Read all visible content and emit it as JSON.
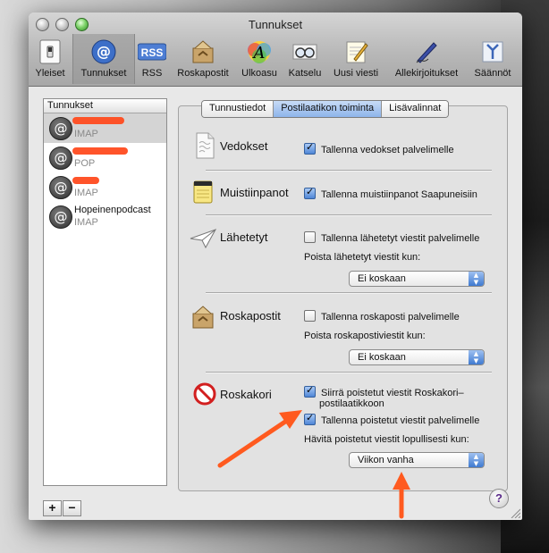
{
  "window": {
    "title": "Tunnukset"
  },
  "toolbar": [
    {
      "name": "yleiset",
      "label": "Yleiset"
    },
    {
      "name": "tunnukset",
      "label": "Tunnukset"
    },
    {
      "name": "rss",
      "label": "RSS"
    },
    {
      "name": "roskapostit",
      "label": "Roskapostit"
    },
    {
      "name": "ulkoasu",
      "label": "Ulkoasu"
    },
    {
      "name": "katselu",
      "label": "Katselu"
    },
    {
      "name": "uusi-viesti",
      "label": "Uusi viesti"
    },
    {
      "name": "allekirjoitukset",
      "label": "Allekirjoitukset"
    },
    {
      "name": "saannot",
      "label": "Säännöt"
    }
  ],
  "toolbar_rss_icon_text": "RSS",
  "accounts": {
    "header": "Tunnukset",
    "items": [
      {
        "name": "",
        "type": "IMAP",
        "selected": true
      },
      {
        "name": "",
        "type": "POP",
        "selected": false
      },
      {
        "name": "",
        "type": "IMAP",
        "selected": false
      },
      {
        "name": "Hopeinenpodcast",
        "type": "IMAP",
        "selected": false
      }
    ],
    "add": "+",
    "remove": "−"
  },
  "tabs": [
    {
      "label": "Tunnustiedot",
      "selected": false
    },
    {
      "label": "Postilaatikon toiminta",
      "selected": true
    },
    {
      "label": "Lisävalinnat",
      "selected": false
    }
  ],
  "sections": {
    "drafts": {
      "label": "Vedokset",
      "cb1": "Tallenna vedokset palvelimelle",
      "cb1_checked": true
    },
    "notes": {
      "label": "Muistiinpanot",
      "cb1": "Tallenna muistiinpanot Saapuneisiin",
      "cb1_checked": true
    },
    "sent": {
      "label": "Lähetetyt",
      "cb1": "Tallenna lähetetyt viestit palvelimelle",
      "cb1_checked": false,
      "sub": "Poista lähetetyt viestit kun:",
      "popup": "Ei koskaan"
    },
    "junk": {
      "label": "Roskapostit",
      "cb1": "Tallenna roskaposti palvelimelle",
      "cb1_checked": false,
      "sub": "Poista roskapostiviestit kun:",
      "popup": "Ei koskaan"
    },
    "trash": {
      "label": "Roskakori",
      "cb1_line1": "Siirrä poistetut viestit Roskakori–",
      "cb1_line2": "postilaatikkoon",
      "cb1_checked": true,
      "cb2": "Tallenna poistetut viestit palvelimelle",
      "cb2_checked": true,
      "sub": "Hävitä poistetut viestit lopullisesti kun:",
      "popup": "Viikon vanha"
    }
  },
  "help": "?",
  "colors": {
    "annotation_arrow": "#ff5a1f",
    "redaction": "#ff4b1f",
    "selected_tab": "#8db4ea"
  },
  "popup_arrows": "▲▼"
}
